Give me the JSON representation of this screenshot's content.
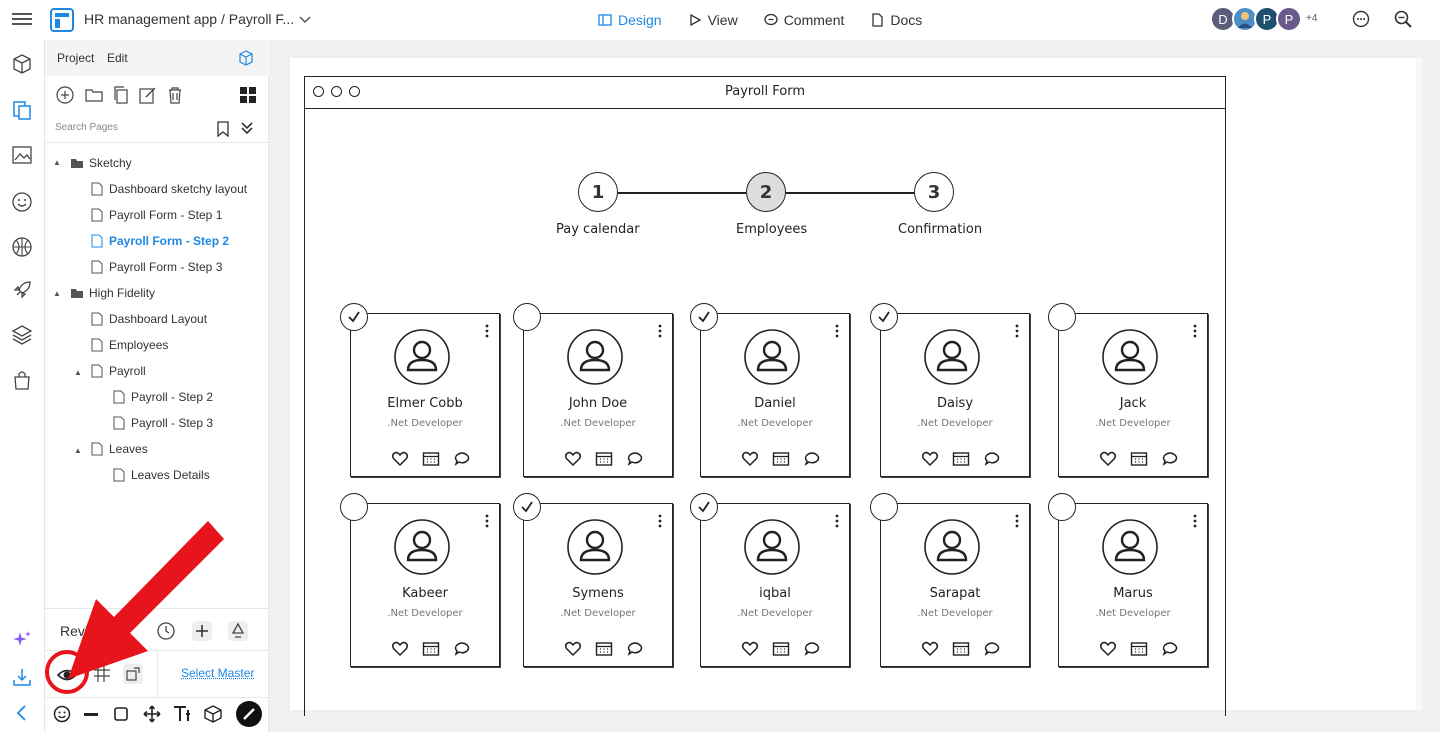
{
  "header": {
    "title": "HR management app / Payroll F...",
    "modes": [
      {
        "label": "Design",
        "active": true
      },
      {
        "label": "View",
        "active": false
      },
      {
        "label": "Comment",
        "active": false
      },
      {
        "label": "Docs",
        "active": false
      }
    ],
    "avatars": [
      "D",
      "",
      "P",
      "P"
    ],
    "extra_count": "+4"
  },
  "panel": {
    "tabs": [
      "Project",
      "Edit"
    ],
    "search_placeholder": "Search Pages",
    "tree": [
      {
        "label": "Sketchy",
        "type": "folder"
      },
      {
        "label": "Dashboard sketchy layout",
        "type": "page"
      },
      {
        "label": "Payroll Form - Step 1",
        "type": "page"
      },
      {
        "label": "Payroll Form - Step 2",
        "type": "page",
        "active": true
      },
      {
        "label": "Payroll Form - Step 3",
        "type": "page"
      },
      {
        "label": "High Fidelity",
        "type": "folder"
      },
      {
        "label": "Dashboard Layout",
        "type": "page"
      },
      {
        "label": "Employees",
        "type": "page"
      },
      {
        "label": "Payroll",
        "type": "page"
      },
      {
        "label": "Payroll - Step 2",
        "type": "page"
      },
      {
        "label": "Payroll - Step 3",
        "type": "page"
      },
      {
        "label": "Leaves",
        "type": "page"
      },
      {
        "label": "Leaves Details",
        "type": "page"
      }
    ],
    "revisions_label": "Revisi",
    "select_master": "Select Master"
  },
  "canvas": {
    "frame_title": "Payroll Form",
    "steps": [
      {
        "number": "1",
        "label": "Pay calendar"
      },
      {
        "number": "2",
        "label": "Employees",
        "current": true
      },
      {
        "number": "3",
        "label": "Confirmation"
      }
    ],
    "employees": [
      {
        "name": "Elmer Cobb",
        "role": ".Net Developer",
        "checked": true
      },
      {
        "name": "John Doe",
        "role": ".Net Developer",
        "checked": false
      },
      {
        "name": "Daniel",
        "role": ".Net Developer",
        "checked": true
      },
      {
        "name": "Daisy",
        "role": ".Net Developer",
        "checked": true
      },
      {
        "name": "Jack",
        "role": ".Net Developer",
        "checked": false
      },
      {
        "name": "Kabeer",
        "role": ".Net Developer",
        "checked": false
      },
      {
        "name": "Symens",
        "role": ".Net Developer",
        "checked": true
      },
      {
        "name": "iqbal",
        "role": ".Net Developer",
        "checked": true
      },
      {
        "name": "Sarapat",
        "role": ".Net Developer",
        "checked": false
      },
      {
        "name": "Marus",
        "role": ".Net Developer",
        "checked": false
      }
    ]
  },
  "colors": {
    "accent": "#1e88e5",
    "annotation": "#e8141b"
  }
}
